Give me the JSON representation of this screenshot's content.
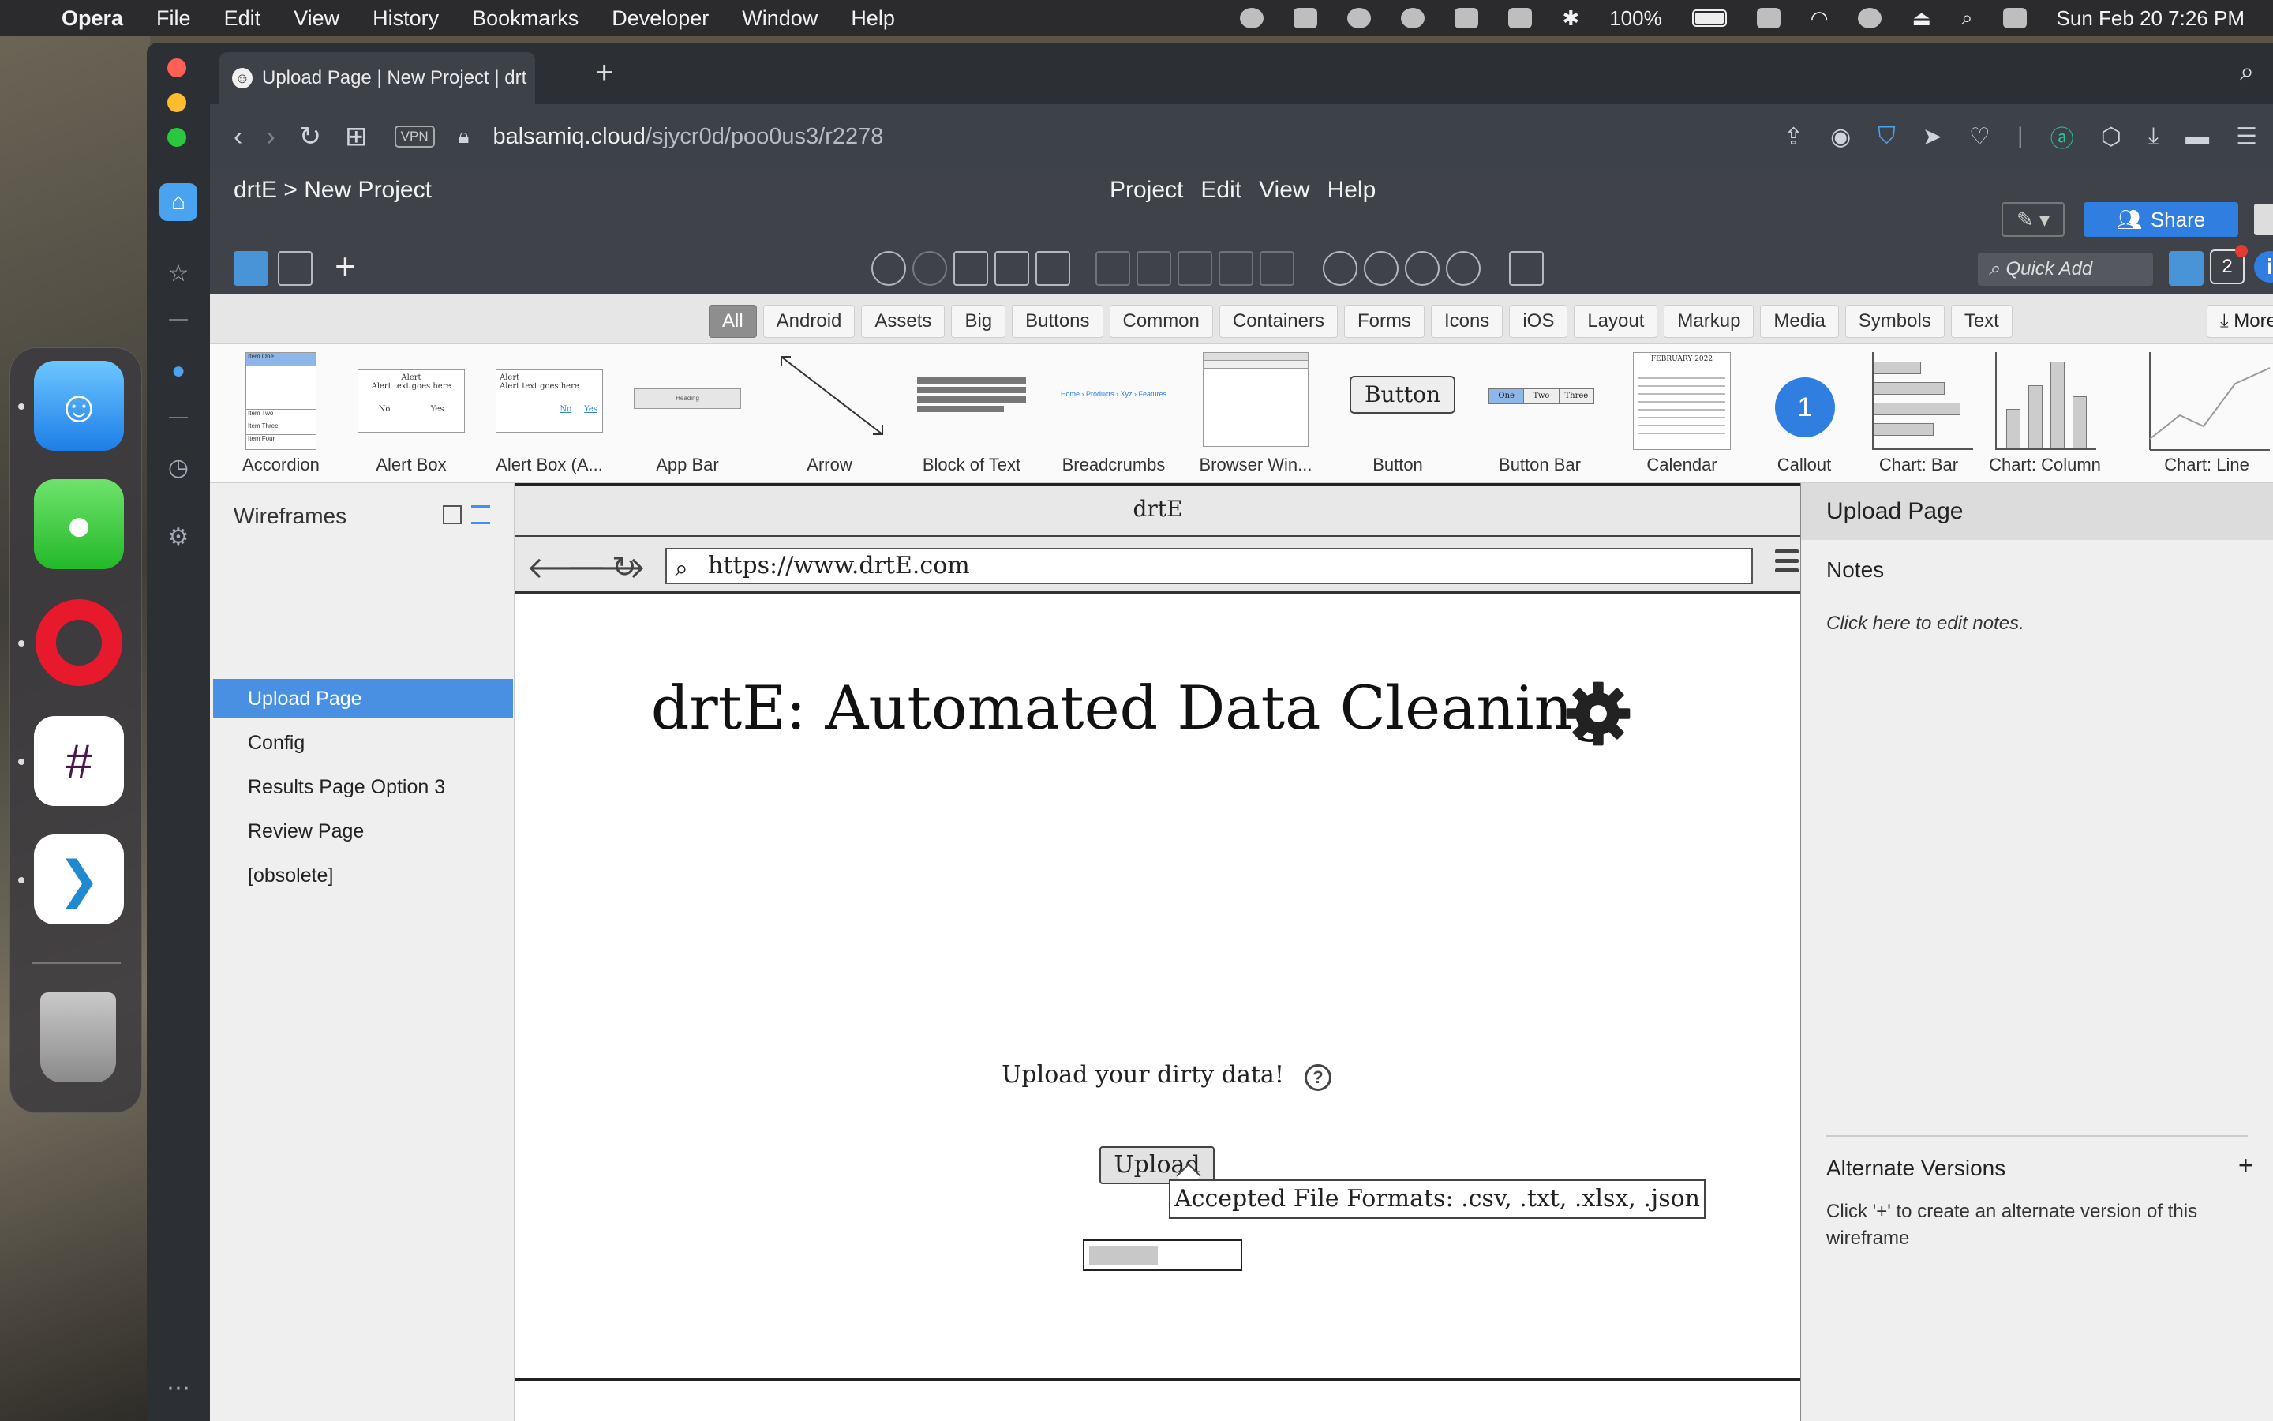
{
  "menubar": {
    "app": "Opera",
    "items": [
      "File",
      "Edit",
      "View",
      "History",
      "Bookmarks",
      "Developer",
      "Window",
      "Help"
    ],
    "battery": "100%",
    "clock": "Sun Feb 20  7:26 PM"
  },
  "browser": {
    "tab_title": "Upload Page | New Project | drt",
    "vpn": "VPN",
    "url_host": "balsamiq.cloud",
    "url_path": "/sjycr0d/poo0us3/r2278"
  },
  "app": {
    "breadcrumb": "drtE  >  New Project",
    "menu": [
      "Project",
      "Edit",
      "View",
      "Help"
    ],
    "share_label": "Share",
    "quick_add_placeholder": "Quick Add",
    "notification_count": "2",
    "accent": "#2f7ee0"
  },
  "filters": {
    "items": [
      "All",
      "Android",
      "Assets",
      "Big",
      "Buttons",
      "Common",
      "Containers",
      "Forms",
      "Icons",
      "iOS",
      "Layout",
      "Markup",
      "Media",
      "Symbols",
      "Text"
    ],
    "active": "All",
    "more_controls": "More Controls..."
  },
  "library": {
    "items": [
      "Accordion",
      "Alert Box",
      "Alert Box (A...",
      "App Bar",
      "Arrow",
      "Block of Text",
      "Breadcrumbs",
      "Browser Win...",
      "Button",
      "Button Bar",
      "Calendar",
      "Callout",
      "Chart: Bar",
      "Chart: Column",
      "Chart: Line"
    ],
    "thumb_text": {
      "accordion_items": [
        "Item One",
        "Item Two",
        "Item Three",
        "Item Four"
      ],
      "alert_title": "Alert",
      "alert_text": "Alert text goes here",
      "alert_no": "No",
      "alert_yes": "Yes",
      "app_bar_heading": "Heading",
      "breadcrumbs": "Home › Products › Xyz › Features",
      "button": "Button",
      "button_bar": [
        "One",
        "Two",
        "Three"
      ],
      "calendar_month": "FEBRUARY 2022",
      "callout": "1"
    }
  },
  "wireframes": {
    "title": "Wireframes",
    "items": [
      "Upload Page",
      "Config",
      "Results Page Option 3",
      "Review Page",
      "[obsolete]"
    ],
    "selected": "Upload Page"
  },
  "canvas": {
    "window_title": "drtE",
    "mock_url": "https://www.drtE.com",
    "heading": "drtE: Automated Data Cleaning",
    "upload_prompt": "Upload your dirty data!",
    "help_glyph": "?",
    "upload_button": "Upload",
    "tooltip": "Accepted File Formats: .csv, .txt, .xlsx, .json",
    "progress": 0.47
  },
  "rightpanel": {
    "title": "Upload Page",
    "notes_label": "Notes",
    "notes_hint": "Click here to edit notes.",
    "alt_label": "Alternate Versions",
    "alt_plus": "+",
    "alt_desc": "Click '+' to create an alternate version of this wireframe"
  }
}
